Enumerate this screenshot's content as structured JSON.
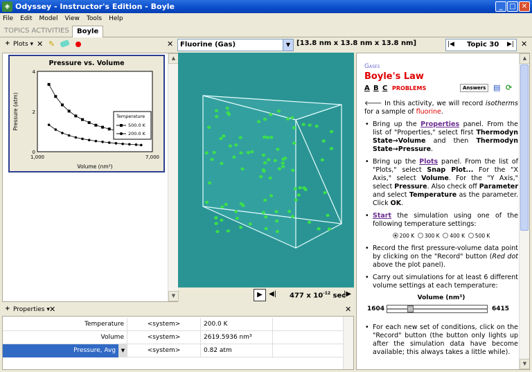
{
  "window": {
    "title": "Odyssey - Instructor's Edition - Boyle"
  },
  "menu": [
    "File",
    "Edit",
    "Model",
    "View",
    "Tools",
    "Help"
  ],
  "tabs": {
    "topics": "TOPICS ACTIVITIES",
    "active": "Boyle"
  },
  "left_toolbar": {
    "plots_label": "Plots"
  },
  "chart_data": {
    "type": "line",
    "title": "Pressure vs. Volume",
    "xlabel": "Volume (nm³)",
    "ylabel": "Pressure (atm)",
    "xlim": [
      1000,
      7000
    ],
    "ylim": [
      0,
      4
    ],
    "x_ticks": [
      "1,000",
      "7,000"
    ],
    "y_ticks": [
      "0",
      "2",
      "4"
    ],
    "legend_title": "Temperature",
    "legend_position": "right",
    "series": [
      {
        "name": "500.0 K",
        "marker": "square",
        "x": [
          1600,
          1950,
          2300,
          2650,
          3000,
          3350,
          3700,
          4050,
          4400,
          4750,
          5100,
          5450,
          6415
        ],
        "y": [
          3.35,
          2.75,
          2.33,
          2.02,
          1.78,
          1.6,
          1.45,
          1.32,
          1.22,
          1.13,
          1.05,
          0.98,
          0.84
        ]
      },
      {
        "name": "200.0 K",
        "marker": "circle",
        "x": [
          1600,
          1950,
          2300,
          2650,
          3000,
          3350,
          3700,
          4050,
          4400,
          4750,
          5100,
          5450,
          5800,
          6150,
          6415
        ],
        "y": [
          1.34,
          1.1,
          0.93,
          0.81,
          0.71,
          0.64,
          0.58,
          0.53,
          0.49,
          0.45,
          0.42,
          0.39,
          0.37,
          0.35,
          0.33
        ]
      }
    ]
  },
  "simulation": {
    "molecule": "Fluorine (Gas)",
    "dimensions": "[13.8 nm x 13.8 nm x 13.8 nm]",
    "time_value": "477 x 10",
    "time_exp": "-12",
    "time_unit": "sec"
  },
  "topic": {
    "label": "Topic 30"
  },
  "content": {
    "section": "Gases",
    "title": "Boyle's Law",
    "tabs": [
      "A",
      "B",
      "C"
    ],
    "problems": "PROBLEMS",
    "answers_btn": "Answers",
    "intro_1": "In this activity, we will record ",
    "intro_isotherms": "isotherms",
    "intro_2": " for a sample of ",
    "intro_fluorine": "fluorine",
    "intro_3": ".",
    "b1_1": "Bring up the ",
    "b1_link": "Properties",
    "b1_2": " panel. From the list of \"Properties,\" select first ",
    "b1_bold1": "Thermodyn State→Volume",
    "b1_3": " and then ",
    "b1_bold2": "Thermodyn State→Pressure",
    "b1_4": ".",
    "b2_1": "Bring up the ",
    "b2_link": "Plots",
    "b2_2": " panel. From the list of \"Plots,\" select ",
    "b2_bold1": "Snap Plot...",
    "b2_3": " For the \"X Axis,\" select ",
    "b2_bold2": "Volume",
    "b2_4": ". For the \"Y Axis,\" select ",
    "b2_bold3": "Pressure",
    "b2_5": ". Also check off ",
    "b2_bold4": "Parameter",
    "b2_6": " and select ",
    "b2_bold5": "Temperature",
    "b2_7": " as the parameter. Click ",
    "b2_bold6": "OK",
    "b2_8": ".",
    "b3_link": "Start",
    "b3_1": " the simulation using one of the following temperature settings:",
    "temps": [
      "200 K",
      "300 K",
      "400 K",
      "500 K"
    ],
    "temps_selected": 0,
    "b4_1": "Record the first pressure-volume data point by clicking on the \"Record\" button (",
    "b4_italic": "Red dot",
    "b4_2": " above the plot panel).",
    "b5": "Carry out simulations for at least 6 different volume settings at each temperature:",
    "slider_label": "Volume (nm³)",
    "slider_min": "1604",
    "slider_max": "6415",
    "slider_value_fraction": 0.07,
    "b6": "For each new set of conditions, click on the \"Record\" button (the button only lights up after the simulation data have become available; this always takes a little while)."
  },
  "properties": {
    "toolbar_label": "Properties",
    "rows": [
      {
        "name": "Temperature",
        "source": "<system>",
        "value": "200.0 K"
      },
      {
        "name": "Volume",
        "source": "<system>",
        "value": "2619.5936 nm³"
      },
      {
        "name": "Pressure, Avg",
        "source": "<system>",
        "value": "0.82 atm"
      }
    ]
  },
  "colors": {
    "accent": "#0a4ccb",
    "sim_bg": "#2a9494",
    "molecule": "#3ce04a",
    "title_red": "#e00000",
    "link_purple": "#6b2d90"
  }
}
